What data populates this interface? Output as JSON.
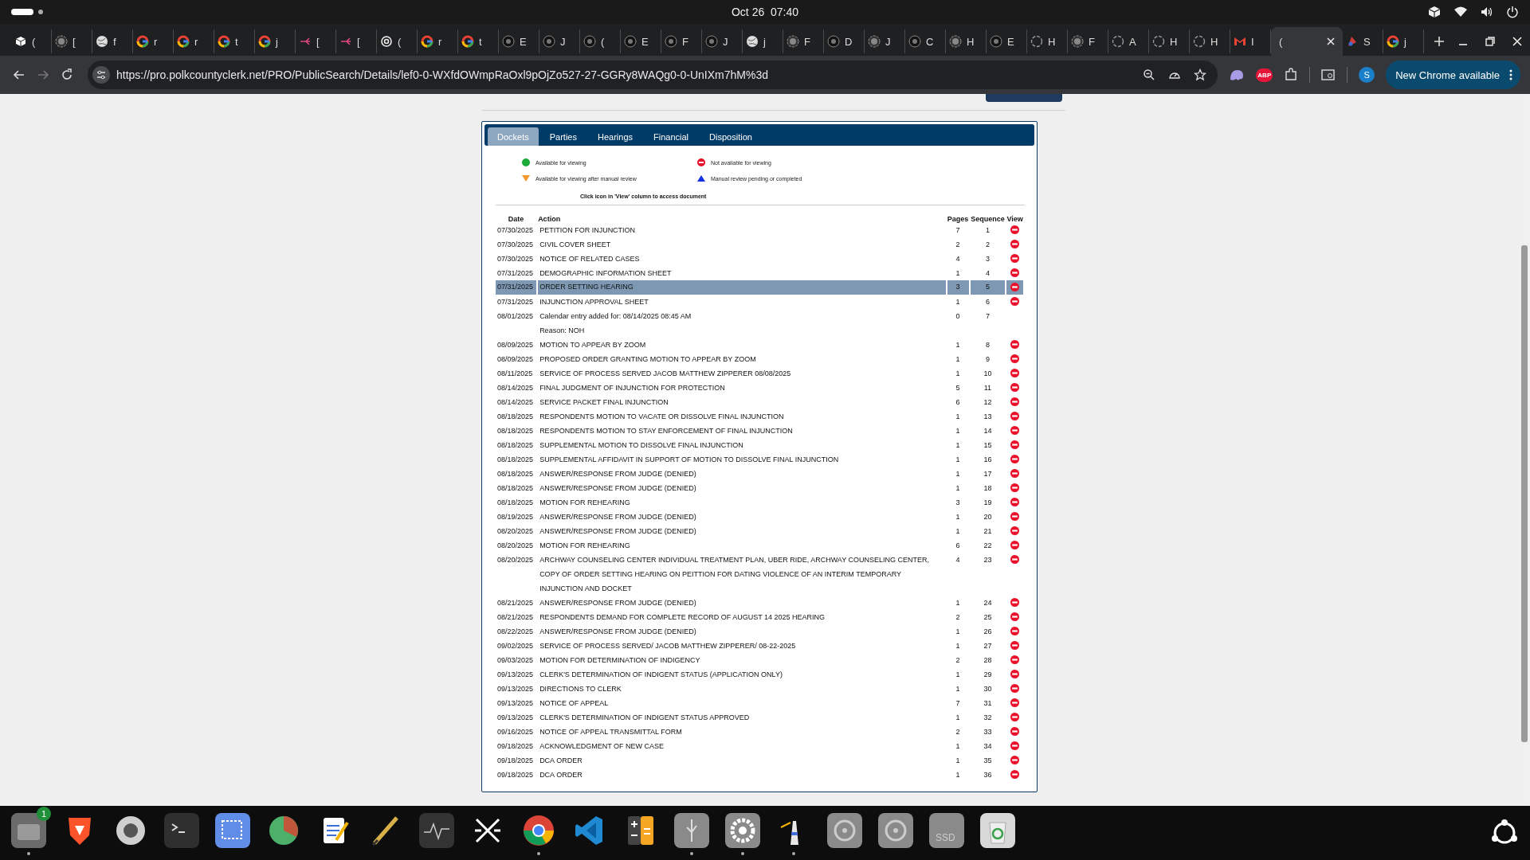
{
  "top_bar": {
    "clock": "Oct 26  07:40"
  },
  "browser": {
    "tabs": [
      {
        "label": "(",
        "kind": "cube",
        "selected": false
      },
      {
        "label": "[",
        "kind": "ring",
        "selected": false
      },
      {
        "label": "f",
        "kind": "globe",
        "selected": false
      },
      {
        "label": "r",
        "kind": "google",
        "selected": false
      },
      {
        "label": "r",
        "kind": "google",
        "selected": false
      },
      {
        "label": "t",
        "kind": "google",
        "selected": false
      },
      {
        "label": "j",
        "kind": "google",
        "selected": false
      },
      {
        "label": "[",
        "kind": "share",
        "selected": false
      },
      {
        "label": "[",
        "kind": "share",
        "selected": false
      },
      {
        "label": "(",
        "kind": "knot",
        "selected": false
      },
      {
        "label": "r",
        "kind": "google",
        "selected": false
      },
      {
        "label": "t",
        "kind": "google",
        "selected": false
      },
      {
        "label": "E",
        "kind": "dark",
        "selected": false
      },
      {
        "label": "J",
        "kind": "dark",
        "selected": false
      },
      {
        "label": "(",
        "kind": "dark",
        "selected": false
      },
      {
        "label": "E",
        "kind": "dark",
        "selected": false
      },
      {
        "label": "F",
        "kind": "dark",
        "selected": false
      },
      {
        "label": "J",
        "kind": "dark",
        "selected": false
      },
      {
        "label": "j",
        "kind": "globe",
        "selected": false
      },
      {
        "label": "F",
        "kind": "ring",
        "selected": false
      },
      {
        "label": "D",
        "kind": "dark",
        "selected": false
      },
      {
        "label": "J",
        "kind": "ring",
        "selected": false
      },
      {
        "label": "C",
        "kind": "dark",
        "selected": false
      },
      {
        "label": "H",
        "kind": "ring",
        "selected": false
      },
      {
        "label": "E",
        "kind": "dark",
        "selected": false
      },
      {
        "label": "H",
        "kind": "dashed",
        "selected": false
      },
      {
        "label": "F",
        "kind": "ring",
        "selected": false
      },
      {
        "label": "A",
        "kind": "dashed",
        "selected": false
      },
      {
        "label": "H",
        "kind": "dashed",
        "selected": false
      },
      {
        "label": "H",
        "kind": "dashed",
        "selected": false
      },
      {
        "label": "I",
        "kind": "mail",
        "selected": false
      },
      {
        "label": "(",
        "kind": "blank",
        "selected": true
      },
      {
        "label": "S",
        "kind": "flag",
        "selected": false
      },
      {
        "label": "j",
        "kind": "google",
        "selected": false
      }
    ],
    "url": "https://pro.polkcountyclerk.net/PRO/PublicSearch/Details/lef0-0-WXfdOWmpRaOxl9pOjZo527-27-GGRy8WAQg0-0-UnIXm7hM%3d",
    "extension_badge": "ABP",
    "profile": "S",
    "update_button": "New Chrome available"
  },
  "page": {
    "tabs": [
      {
        "label": "Dockets",
        "selected": true
      },
      {
        "label": "Parties",
        "selected": false
      },
      {
        "label": "Hearings",
        "selected": false
      },
      {
        "label": "Financial",
        "selected": false
      },
      {
        "label": "Disposition",
        "selected": false
      }
    ],
    "legend": [
      {
        "kind": "available",
        "label": "Available for viewing"
      },
      {
        "kind": "unavailable",
        "label": "Not available for viewing"
      },
      {
        "kind": "manual",
        "label": "Available for viewing after manual review"
      },
      {
        "kind": "pending",
        "label": "Manual review pending or completed"
      }
    ],
    "instruction": "Click icon in 'View' column to access document",
    "columns": [
      "Date",
      "Action",
      "Pages",
      "Sequence",
      "View"
    ],
    "rows": [
      {
        "date": "07/30/2025",
        "action": "PETITION FOR INJUNCTION",
        "pages": "7",
        "sequence": "1",
        "kind": "unavailable",
        "selected": false
      },
      {
        "date": "07/30/2025",
        "action": "CIVIL COVER SHEET",
        "pages": "2",
        "sequence": "2",
        "kind": "unavailable",
        "selected": false
      },
      {
        "date": "07/30/2025",
        "action": "NOTICE OF RELATED CASES",
        "pages": "4",
        "sequence": "3",
        "kind": "unavailable",
        "selected": false
      },
      {
        "date": "07/31/2025",
        "action": "DEMOGRAPHIC INFORMATION SHEET",
        "pages": "1",
        "sequence": "4",
        "kind": "unavailable",
        "selected": false
      },
      {
        "date": "07/31/2025",
        "action": "ORDER SETTING HEARING",
        "pages": "3",
        "sequence": "5",
        "kind": "unavailable",
        "selected": true
      },
      {
        "date": "07/31/2025",
        "action": "INJUNCTION APPROVAL SHEET",
        "pages": "1",
        "sequence": "6",
        "kind": "unavailable",
        "selected": false
      },
      {
        "date": "08/01/2025",
        "action": "Calendar entry added for: 08/14/2025 08:45 AM",
        "note": "Reason: NOH",
        "pages": "0",
        "sequence": "7",
        "kind": "entry",
        "selected": false
      },
      {
        "date": "08/09/2025",
        "action": "MOTION TO APPEAR BY ZOOM",
        "pages": "1",
        "sequence": "8",
        "kind": "unavailable",
        "selected": false
      },
      {
        "date": "08/09/2025",
        "action": "PROPOSED ORDER GRANTING MOTION TO APPEAR BY ZOOM",
        "pages": "1",
        "sequence": "9",
        "kind": "unavailable",
        "selected": false
      },
      {
        "date": "08/11/2025",
        "action": "SERVICE OF PROCESS SERVED JACOB MATTHEW ZIPPERER 08/08/2025",
        "pages": "1",
        "sequence": "10",
        "kind": "unavailable",
        "selected": false
      },
      {
        "date": "08/14/2025",
        "action": "FINAL JUDGMENT OF INJUNCTION FOR PROTECTION",
        "pages": "5",
        "sequence": "11",
        "kind": "unavailable",
        "selected": false
      },
      {
        "date": "08/14/2025",
        "action": "SERVICE PACKET FINAL INJUNCTION",
        "pages": "6",
        "sequence": "12",
        "kind": "unavailable",
        "selected": false
      },
      {
        "date": "08/18/2025",
        "action": "RESPONDENTS MOTION TO VACATE OR DISSOLVE FINAL INJUNCTION",
        "pages": "1",
        "sequence": "13",
        "kind": "unavailable",
        "selected": false
      },
      {
        "date": "08/18/2025",
        "action": "RESPONDENTS MOTION TO STAY ENFORCEMENT OF FINAL INJUNCTION",
        "pages": "1",
        "sequence": "14",
        "kind": "unavailable",
        "selected": false
      },
      {
        "date": "08/18/2025",
        "action": "SUPPLEMENTAL MOTION TO DISSOLVE FINAL INJUNCTION",
        "pages": "1",
        "sequence": "15",
        "kind": "unavailable",
        "selected": false
      },
      {
        "date": "08/18/2025",
        "action": "SUPPLEMENTAL AFFIDAVIT IN SUPPORT OF MOTION TO DISSOLVE FINAL INJUNCTION",
        "pages": "1",
        "sequence": "16",
        "kind": "unavailable",
        "selected": false
      },
      {
        "date": "08/18/2025",
        "action": "ANSWER/RESPONSE FROM JUDGE (DENIED)",
        "pages": "1",
        "sequence": "17",
        "kind": "unavailable",
        "selected": false
      },
      {
        "date": "08/18/2025",
        "action": "ANSWER/RESPONSE FROM JUDGE (DENIED)",
        "pages": "1",
        "sequence": "18",
        "kind": "unavailable",
        "selected": false
      },
      {
        "date": "08/18/2025",
        "action": "MOTION FOR REHEARING",
        "pages": "3",
        "sequence": "19",
        "kind": "unavailable",
        "selected": false
      },
      {
        "date": "08/19/2025",
        "action": "ANSWER/RESPONSE FROM JUDGE (DENIED)",
        "pages": "1",
        "sequence": "20",
        "kind": "unavailable",
        "selected": false
      },
      {
        "date": "08/20/2025",
        "action": "ANSWER/RESPONSE FROM JUDGE (DENIED)",
        "pages": "1",
        "sequence": "21",
        "kind": "unavailable",
        "selected": false
      },
      {
        "date": "08/20/2025",
        "action": "MOTION FOR REHEARING",
        "pages": "6",
        "sequence": "22",
        "kind": "unavailable",
        "selected": false
      },
      {
        "date": "08/20/2025",
        "action": "ARCHWAY COUNSELING CENTER INDIVIDUAL TREATMENT PLAN, UBER RIDE, ARCHWAY COUNSELING CENTER, COPY OF ORDER SETTING HEARING ON PEITTION FOR DATING VIOLENCE OF AN INTERIM TEMPORARY INJUNCTION AND DOCKET",
        "pages": "4",
        "sequence": "23",
        "kind": "unavailable",
        "selected": false
      },
      {
        "date": "08/21/2025",
        "action": "ANSWER/RESPONSE FROM JUDGE (DENIED)",
        "pages": "1",
        "sequence": "24",
        "kind": "unavailable",
        "selected": false
      },
      {
        "date": "08/21/2025",
        "action": "RESPONDENTS DEMAND FOR COMPLETE RECORD OF AUGUST 14 2025 HEARING",
        "pages": "2",
        "sequence": "25",
        "kind": "unavailable",
        "selected": false
      },
      {
        "date": "08/22/2025",
        "action": "ANSWER/RESPONSE FROM JUDGE (DENIED)",
        "pages": "1",
        "sequence": "26",
        "kind": "unavailable",
        "selected": false
      },
      {
        "date": "09/02/2025",
        "action": "SERVICE OF PROCESS SERVED/ JACOB MATTHEW ZIPPERER/ 08-22-2025",
        "pages": "1",
        "sequence": "27",
        "kind": "unavailable",
        "selected": false
      },
      {
        "date": "09/03/2025",
        "action": "MOTION FOR DETERMINATION OF INDIGENCY",
        "pages": "2",
        "sequence": "28",
        "kind": "unavailable",
        "selected": false
      },
      {
        "date": "09/13/2025",
        "action": "CLERK'S DETERMINATION OF INDIGENT STATUS (APPLICATION ONLY)",
        "pages": "1",
        "sequence": "29",
        "kind": "unavailable",
        "selected": false
      },
      {
        "date": "09/13/2025",
        "action": "DIRECTIONS TO CLERK",
        "pages": "1",
        "sequence": "30",
        "kind": "unavailable",
        "selected": false
      },
      {
        "date": "09/13/2025",
        "action": "NOTICE OF APPEAL",
        "pages": "7",
        "sequence": "31",
        "kind": "unavailable",
        "selected": false
      },
      {
        "date": "09/13/2025",
        "action": "CLERK'S DETERMINATION OF INDIGENT STATUS APPROVED",
        "pages": "1",
        "sequence": "32",
        "kind": "unavailable",
        "selected": false
      },
      {
        "date": "09/16/2025",
        "action": "NOTICE OF APPEAL TRANSMITTAL FORM",
        "pages": "2",
        "sequence": "33",
        "kind": "unavailable",
        "selected": false
      },
      {
        "date": "09/18/2025",
        "action": "ACKNOWLEDGMENT OF NEW CASE",
        "pages": "1",
        "sequence": "34",
        "kind": "unavailable",
        "selected": false
      },
      {
        "date": "09/18/2025",
        "action": "DCA ORDER",
        "pages": "1",
        "sequence": "35",
        "kind": "unavailable",
        "selected": false
      },
      {
        "date": "09/18/2025",
        "action": "DCA ORDER",
        "pages": "1",
        "sequence": "36",
        "kind": "unavailable",
        "selected": false
      }
    ]
  },
  "dock": {
    "apps": [
      {
        "kind": "files",
        "badge": "1",
        "running": true
      },
      {
        "kind": "shield",
        "running": false
      },
      {
        "kind": "wheel",
        "running": false
      },
      {
        "kind": "terminal",
        "running": false
      },
      {
        "kind": "screenshot",
        "running": false
      },
      {
        "kind": "pie",
        "running": false
      },
      {
        "kind": "notepad",
        "running": false
      },
      {
        "kind": "pen",
        "running": false
      },
      {
        "kind": "monitor",
        "running": false
      },
      {
        "kind": "network",
        "running": false
      },
      {
        "kind": "browser",
        "running": true
      },
      {
        "kind": "code",
        "running": false
      },
      {
        "kind": "calculator",
        "running": false
      },
      {
        "kind": "usb",
        "running": true
      },
      {
        "kind": "settings",
        "running": true
      },
      {
        "kind": "lighthouse",
        "running": true
      },
      {
        "kind": "disc",
        "running": false
      },
      {
        "kind": "disc",
        "running": false
      },
      {
        "kind": "drive",
        "label": "SSD",
        "running": false
      },
      {
        "kind": "trash",
        "running": false
      }
    ]
  }
}
